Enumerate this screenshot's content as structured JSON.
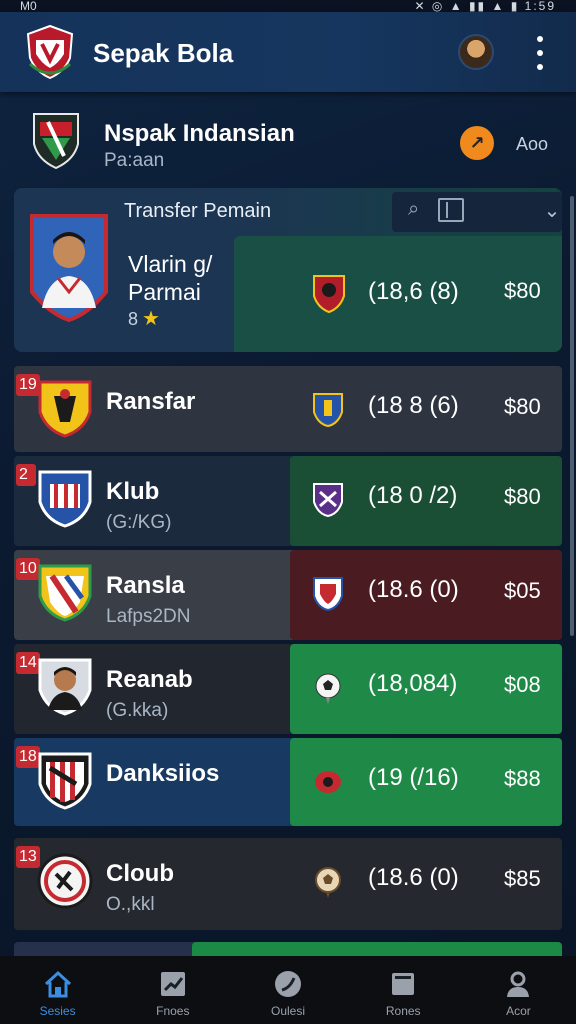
{
  "status_bar": {
    "left": "M0",
    "right": "✕ ◎ ▲ ▮▮ ▲ ▮ 1:59"
  },
  "app": {
    "title": "Sepak Bola",
    "logo_icon": "club-crest-icon",
    "menu_icon": "kebab-menu-icon"
  },
  "league": {
    "name": "Nspak Indansian",
    "sub": "Pa:aan",
    "action_label": "Aoo",
    "action_icon": "arrow-icon"
  },
  "featured": {
    "title": "Transfer Pemain",
    "player_name": "Vlarin g/\nParmai",
    "rating": "8",
    "stat": "(18,6 (8)",
    "price": "$80"
  },
  "rows": [
    {
      "num": "19",
      "name": "Ransfar",
      "sub": "",
      "stat": "(18 8 (6)",
      "price": "$80"
    },
    {
      "num": "2",
      "name": "Klub",
      "sub": "(G:/KG)",
      "stat": "(18 0 /2)",
      "price": "$80"
    },
    {
      "num": "10",
      "name": "Ransla",
      "sub": "Lafps2DN",
      "stat": "(18.6 (0)",
      "price": "$05"
    },
    {
      "num": "14",
      "name": "Reanab",
      "sub": "(G.kka)",
      "stat": "(18,084)",
      "price": "$08"
    },
    {
      "num": "18",
      "name": "Danksiios",
      "sub": "",
      "stat": "(19 (/16)",
      "price": "$88"
    },
    {
      "num": "13",
      "name": "Cloub",
      "sub": "O.,kkl",
      "stat": "(18.6 (0)",
      "price": "$85"
    }
  ],
  "nav": [
    {
      "label": "Sesies",
      "icon": "home-icon"
    },
    {
      "label": "Fnoes",
      "icon": "chart-icon"
    },
    {
      "label": "Oulesi",
      "icon": "ball-icon"
    },
    {
      "label": "Rones",
      "icon": "box-icon"
    },
    {
      "label": "Acor",
      "icon": "user-icon"
    }
  ],
  "colors": {
    "accent_blue": "#3c8fe0",
    "badge_red": "#c62a31",
    "green": "#1b8a45",
    "orange": "#f08a1c"
  }
}
